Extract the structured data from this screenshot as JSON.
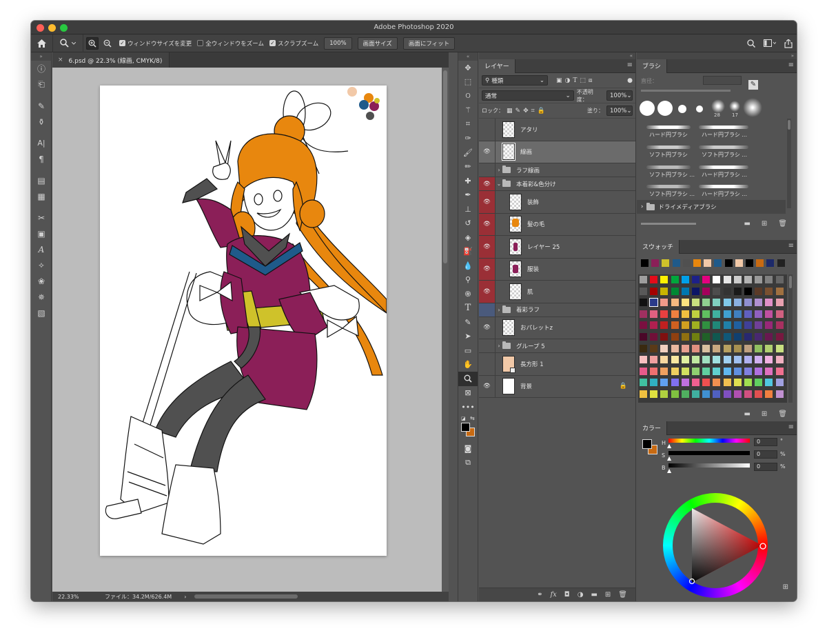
{
  "window": {
    "title": "Adobe Photoshop 2020"
  },
  "options_bar": {
    "checks": [
      {
        "label": "ウィンドウサイズを変更",
        "checked": true
      },
      {
        "label": "全ウィンドウをズーム",
        "checked": false
      },
      {
        "label": "スクラブズーム",
        "checked": true
      }
    ],
    "buttons": [
      "100%",
      "画面サイズ",
      "画面にフィット"
    ]
  },
  "document": {
    "tab_title": "6.psd @ 22.3% (線画, CMYK/8)",
    "status_zoom": "22.33%",
    "status_file": "ファイル：34.2M/626.4M"
  },
  "layers_panel": {
    "tab": "レイヤー",
    "filter_kind": "種類",
    "blend_mode": "通常",
    "opacity_label": "不透明度：",
    "opacity_value": "100%",
    "lock_label": "ロック：",
    "fill_label": "塗り：",
    "fill_value": "100%",
    "layers": [
      {
        "name": "アタリ",
        "type": "layer",
        "visible": false,
        "highlight": "none",
        "indent": 0,
        "selected": false
      },
      {
        "name": "線画",
        "type": "layer",
        "visible": true,
        "highlight": "none",
        "indent": 0,
        "selected": true
      },
      {
        "name": "ラフ線画",
        "type": "folder",
        "visible": false,
        "highlight": "none",
        "indent": 0,
        "expanded": false
      },
      {
        "name": "本着彩&色分け",
        "type": "folder",
        "visible": true,
        "highlight": "red",
        "indent": 0,
        "expanded": true
      },
      {
        "name": "装飾",
        "type": "layer",
        "visible": true,
        "highlight": "red",
        "indent": 1,
        "selected": false
      },
      {
        "name": "髪の毛",
        "type": "layer",
        "visible": true,
        "highlight": "red",
        "indent": 1,
        "selected": false
      },
      {
        "name": "レイヤー 25",
        "type": "layer",
        "visible": true,
        "highlight": "red",
        "indent": 1,
        "selected": false
      },
      {
        "name": "服装",
        "type": "layer",
        "visible": true,
        "highlight": "red",
        "indent": 1,
        "selected": false
      },
      {
        "name": "肌",
        "type": "layer",
        "visible": true,
        "highlight": "red",
        "indent": 1,
        "selected": false
      },
      {
        "name": "着彩ラフ",
        "type": "folder",
        "visible": false,
        "highlight": "blue",
        "indent": 0,
        "expanded": false
      },
      {
        "name": "おパレットz",
        "type": "layer",
        "visible": true,
        "highlight": "none",
        "indent": 0,
        "selected": false
      },
      {
        "name": "グループ 5",
        "type": "folder",
        "visible": false,
        "highlight": "none",
        "indent": 0,
        "expanded": false
      },
      {
        "name": "長方形 1",
        "type": "layer",
        "visible": false,
        "highlight": "none",
        "indent": 0,
        "selected": false
      },
      {
        "name": "背景",
        "type": "layer",
        "visible": true,
        "highlight": "none",
        "indent": 0,
        "selected": false,
        "locked": true
      }
    ]
  },
  "brushes_panel": {
    "tab": "ブラシ",
    "size_label": "直径：",
    "tip_numbers": [
      "28",
      "17"
    ],
    "presets": [
      "ハード円ブラシ",
      "ハード円ブラシ ...",
      "ソフト円ブラシ",
      "ソフト円ブラシ ...",
      "ソフト円ブラシ ...",
      "ハード円ブラシ ...",
      "ソフト円ブラシ ...",
      "ハード円ブラシ ..."
    ],
    "group": "ドライメディアブラシ"
  },
  "swatches_panel": {
    "tab": "スウォッチ"
  },
  "color_panel": {
    "tab": "カラー",
    "sliders": [
      {
        "label": "H",
        "value": "0",
        "unit": "°"
      },
      {
        "label": "S",
        "value": "0",
        "unit": "%"
      },
      {
        "label": "B",
        "value": "0",
        "unit": "%"
      }
    ],
    "foreground": "#000000",
    "background": "#c86a12"
  },
  "colors": {
    "hair": "#e8870e",
    "kimono": "#8b1f58",
    "tights": "#505050",
    "sash": "#cfc22a",
    "collar": "#1f5a8a"
  }
}
